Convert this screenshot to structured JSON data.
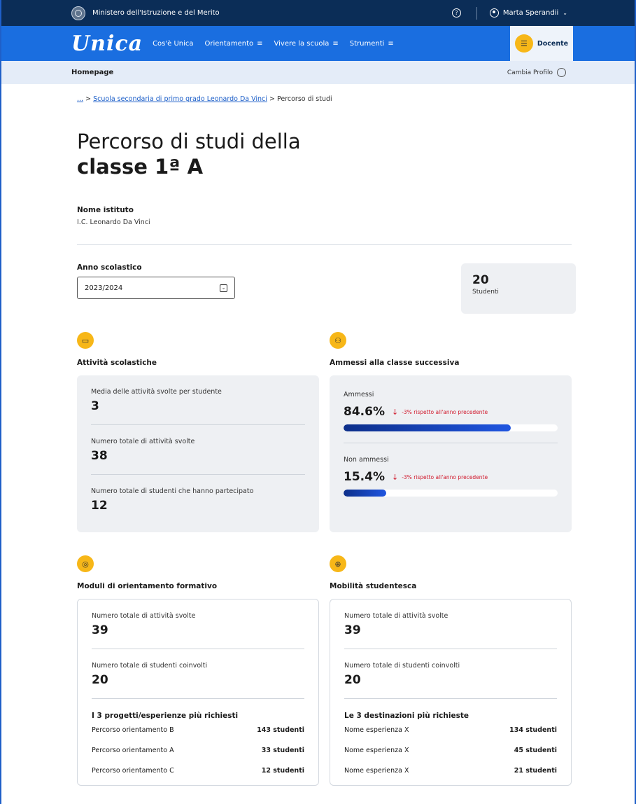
{
  "topbar": {
    "ministry": "Ministero dell'Istruzione e del Merito",
    "help_icon": "help-circle-icon",
    "user_name": "Marta Sperandii",
    "chevron": "⌄"
  },
  "nav": {
    "logo": "Unica",
    "items": [
      {
        "label": "Cos'è Unica",
        "menu": ""
      },
      {
        "label": "Orientamento",
        "menu": "≡"
      },
      {
        "label": "Vivere la scuola",
        "menu": "≡"
      },
      {
        "label": "Strumenti",
        "menu": "≡"
      }
    ],
    "role": "Docente"
  },
  "subbar": {
    "home": "Homepage",
    "change_profile": "Cambia Profilo"
  },
  "breadcrumb": {
    "ellipsis": "...",
    "school": "Scuola secondaria di primo grado Leonardo Da Vinci",
    "separator": ">",
    "current": "Percorso di studi"
  },
  "title": {
    "line1": "Percorso di studi della",
    "line2": "classe 1ª A"
  },
  "institute": {
    "label": "Nome istituto",
    "value": "I.C. Leonardo Da Vinci"
  },
  "year": {
    "label": "Anno scolastico",
    "value": "2023/2024"
  },
  "students": {
    "number": "20",
    "label": "Studenti"
  },
  "activities": {
    "title": "Attività scolastiche",
    "metrics": [
      {
        "label": "Media delle attività svolte per studente",
        "value": "3"
      },
      {
        "label": "Numero totale di attività svolte",
        "value": "38"
      },
      {
        "label": "Numero totale di studenti che hanno partecipato",
        "value": "12"
      }
    ]
  },
  "admitted": {
    "title": "Ammessi alla classe successiva",
    "rows": [
      {
        "label": "Ammessi",
        "pct": "84.6%",
        "delta": "-3% rispetto all'anno precedente",
        "fill": 0.78
      },
      {
        "label": "Non ammessi",
        "pct": "15.4%",
        "delta": "-3% rispetto all'anno precedente",
        "fill": 0.2
      }
    ]
  },
  "modules": {
    "title": "Moduli di orientamento formativo",
    "metrics": [
      {
        "label": "Numero totale di attività svolte",
        "value": "39"
      },
      {
        "label": "Numero totale di studenti coinvolti",
        "value": "20"
      }
    ],
    "top_title": "I 3 progetti/esperienze più richiesti",
    "top": [
      {
        "name": "Percorso orientamento B",
        "count": "143 studenti"
      },
      {
        "name": "Percorso orientamento A",
        "count": "33 studenti"
      },
      {
        "name": "Percorso orientamento C",
        "count": "12 studenti"
      }
    ]
  },
  "mobility": {
    "title": "Mobilità studentesca",
    "metrics": [
      {
        "label": "Numero totale di attività svolte",
        "value": "39"
      },
      {
        "label": "Numero totale di studenti coinvolti",
        "value": "20"
      }
    ],
    "top_title": "Le 3 destinazioni più richieste",
    "top": [
      {
        "name": "Nome esperienza X",
        "count": "134 studenti"
      },
      {
        "name": "Nome esperienza X",
        "count": "45 studenti"
      },
      {
        "name": "Nome esperienza X",
        "count": "21 studenti"
      }
    ]
  },
  "colors": {
    "topbar": "#0b2d57",
    "nav": "#1a6ee0",
    "accent": "#f7b718",
    "negative": "#d11b2e",
    "bar": "#1f55e0"
  }
}
